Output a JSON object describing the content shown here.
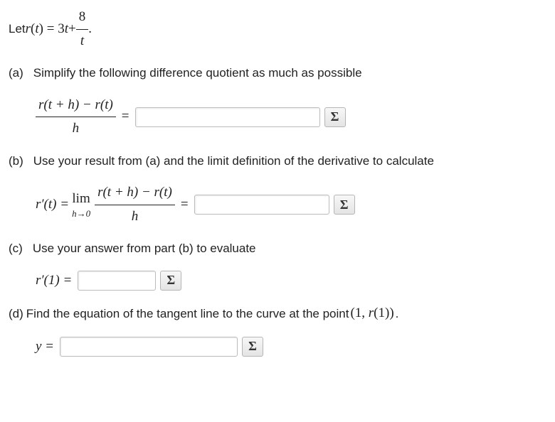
{
  "intro_prefix": "Let ",
  "intro_r": "r",
  "intro_lp": "(",
  "intro_t": "t",
  "intro_rp": ") = 3",
  "intro_t2": "t",
  "intro_plus": " + ",
  "intro_frac_num": "8",
  "intro_frac_den": "t",
  "intro_period": ".",
  "parts": {
    "a": {
      "label": "(a)",
      "text": "Simplify the following difference quotient as much as possible"
    },
    "b": {
      "label": "(b)",
      "text": "Use your result from (a) and the limit definition of the derivative to calculate"
    },
    "c": {
      "label": "(c)",
      "text": "Use your answer from part (b) to evaluate"
    },
    "d": {
      "label": "(d)",
      "text_before": "Find the equation of the tangent line to the curve at the point ",
      "point": "(1, r(1))",
      "text_after": "."
    }
  },
  "expr_a_num": "r(t + h) − r(t)",
  "expr_a_den": "h",
  "expr_b_lhs": "r′(t) = ",
  "lim_top": "lim",
  "lim_bot": "h→0",
  "expr_c": "r′(1) =",
  "expr_d": "y =",
  "equals": "=",
  "sigma": "Σ",
  "inputs": {
    "a": "",
    "b": "",
    "c": "",
    "d": ""
  }
}
